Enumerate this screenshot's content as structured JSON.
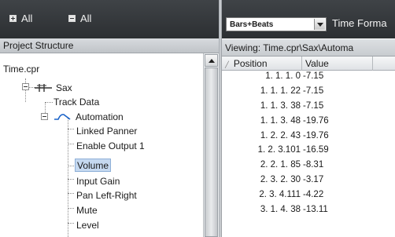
{
  "left_toolbar": {
    "expand_all_label": "All",
    "collapse_all_label": "All"
  },
  "right_toolbar": {
    "format_value": "Bars+Beats",
    "format_label": "Time Forma"
  },
  "project_structure": {
    "header": "Project Structure",
    "project": "Time.cpr",
    "track": "Sax",
    "track_data": "Track Data",
    "automation": "Automation",
    "params": [
      "Linked Panner",
      "Enable Output 1",
      "Volume",
      "Input Gain",
      "Pan Left-Right",
      "Mute",
      "Level"
    ],
    "selected": "Volume"
  },
  "viewer": {
    "viewing": "Viewing: Time.cpr\\Sax\\Automa",
    "columns": [
      "Position",
      "Value"
    ],
    "rows": [
      {
        "pos": "1. 1. 1.   0",
        "val": "-7.15"
      },
      {
        "pos": "1. 1. 1.  22",
        "val": "-7.15"
      },
      {
        "pos": "1. 1. 3.  38",
        "val": "-7.15"
      },
      {
        "pos": "1. 1. 3.  48",
        "val": "-19.76"
      },
      {
        "pos": "1. 2. 2.  43",
        "val": "-19.76"
      },
      {
        "pos": "1. 2. 3.101",
        "val": "-16.59"
      },
      {
        "pos": "2. 2. 1.  85",
        "val": "-8.31"
      },
      {
        "pos": "2. 3. 2.  30",
        "val": "-3.17"
      },
      {
        "pos": "2. 3. 4.111",
        "val": "-4.22"
      },
      {
        "pos": "3. 1. 4.  38",
        "val": "-13.11"
      }
    ]
  },
  "colors": {
    "toolbar_bg": "#2f3236",
    "selection": "#c6d9f0",
    "curve": "#1a63c9"
  }
}
